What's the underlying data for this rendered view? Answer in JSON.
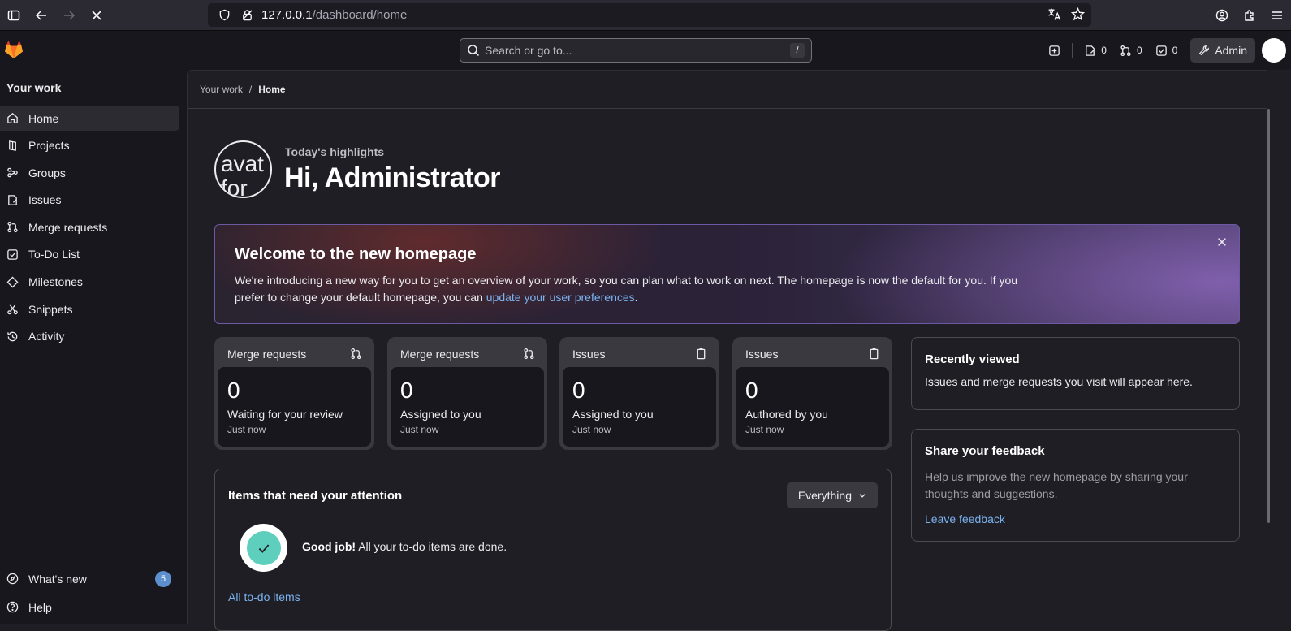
{
  "browser": {
    "url_host": "127.0.0.1",
    "url_path": "/dashboard/home"
  },
  "topbar": {
    "search_placeholder": "Search or go to...",
    "search_shortcut": "/",
    "issues_count": "0",
    "mr_count": "0",
    "todo_count": "0",
    "admin_label": "Admin"
  },
  "sidebar": {
    "title": "Your work",
    "items": [
      {
        "label": "Home",
        "icon": "home-icon"
      },
      {
        "label": "Projects",
        "icon": "project-icon"
      },
      {
        "label": "Groups",
        "icon": "group-icon"
      },
      {
        "label": "Issues",
        "icon": "issues-icon"
      },
      {
        "label": "Merge requests",
        "icon": "merge-request-icon"
      },
      {
        "label": "To-Do List",
        "icon": "todo-icon"
      },
      {
        "label": "Milestones",
        "icon": "milestone-icon"
      },
      {
        "label": "Snippets",
        "icon": "snippet-icon"
      },
      {
        "label": "Activity",
        "icon": "history-icon"
      }
    ],
    "whats_new": "What's new",
    "whats_new_count": "5",
    "help": "Help"
  },
  "breadcrumb": {
    "parent": "Your work",
    "separator": "/",
    "current": "Home"
  },
  "greeting": {
    "avatar_text": "avat for",
    "subtitle": "Today's highlights",
    "title": "Hi, Administrator"
  },
  "welcome": {
    "title": "Welcome to the new homepage",
    "text": "We're introducing a new way for you to get an overview of your work, so you can plan what to work on next. The homepage is now the default for you. If you prefer to change your default homepage, you can ",
    "link": "update your user preferences",
    "tail": "."
  },
  "cards": [
    {
      "title": "Merge requests",
      "count": "0",
      "label": "Waiting for your review",
      "time": "Just now"
    },
    {
      "title": "Merge requests",
      "count": "0",
      "label": "Assigned to you",
      "time": "Just now"
    },
    {
      "title": "Issues",
      "count": "0",
      "label": "Assigned to you",
      "time": "Just now"
    },
    {
      "title": "Issues",
      "count": "0",
      "label": "Authored by you",
      "time": "Just now"
    }
  ],
  "attention": {
    "title": "Items that need your attention",
    "filter": "Everything",
    "good_job": "Good job!",
    "done_text": " All your to-do items are done.",
    "all_todo_link": "All to-do items"
  },
  "recently_viewed": {
    "title": "Recently viewed",
    "text": "Issues and merge requests you visit will appear here."
  },
  "feedback": {
    "title": "Share your feedback",
    "text": "Help us improve the new homepage by sharing your thoughts and suggestions.",
    "link": "Leave feedback"
  },
  "colors": {
    "accent_link": "#7bb3f0",
    "success": "#5fcfbd",
    "badge": "#5d8fcf"
  }
}
